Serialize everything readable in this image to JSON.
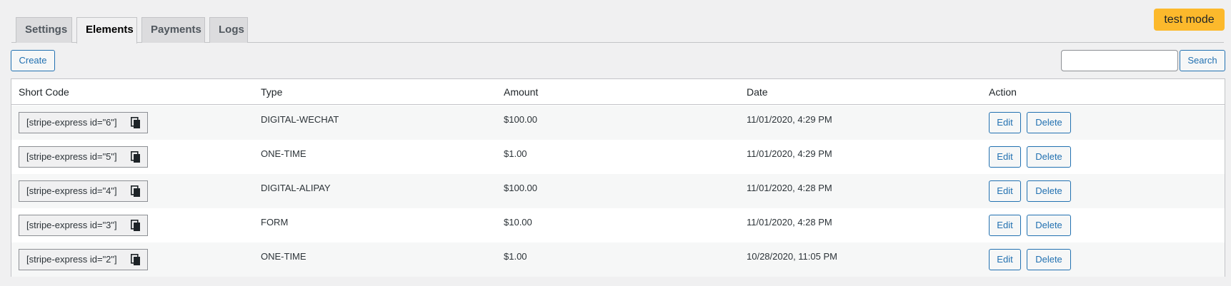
{
  "tabs": [
    {
      "label": "Settings",
      "active": false
    },
    {
      "label": "Elements",
      "active": true
    },
    {
      "label": "Payments",
      "active": false
    },
    {
      "label": "Logs",
      "active": false
    }
  ],
  "badge": {
    "label": "test mode",
    "color": "#fcb92c"
  },
  "toolbar": {
    "create_label": "Create",
    "search_value": "",
    "search_label": "Search"
  },
  "table": {
    "columns": [
      "Short Code",
      "Type",
      "Amount",
      "Date",
      "Action"
    ],
    "edit_label": "Edit",
    "delete_label": "Delete",
    "rows": [
      {
        "shortcode": "[stripe-express id=\"6\"]",
        "type": "DIGITAL-WECHAT",
        "amount": "$100.00",
        "date": "11/01/2020, 4:29 PM"
      },
      {
        "shortcode": "[stripe-express id=\"5\"]",
        "type": "ONE-TIME",
        "amount": "$1.00",
        "date": "11/01/2020, 4:29 PM"
      },
      {
        "shortcode": "[stripe-express id=\"4\"]",
        "type": "DIGITAL-ALIPAY",
        "amount": "$100.00",
        "date": "11/01/2020, 4:28 PM"
      },
      {
        "shortcode": "[stripe-express id=\"3\"]",
        "type": "FORM",
        "amount": "$10.00",
        "date": "11/01/2020, 4:28 PM"
      },
      {
        "shortcode": "[stripe-express id=\"2\"]",
        "type": "ONE-TIME",
        "amount": "$1.00",
        "date": "10/28/2020, 11:05 PM"
      }
    ]
  },
  "colors": {
    "accent": "#2271b1",
    "border": "#c3c4c7",
    "background": "#f0f0f1"
  }
}
